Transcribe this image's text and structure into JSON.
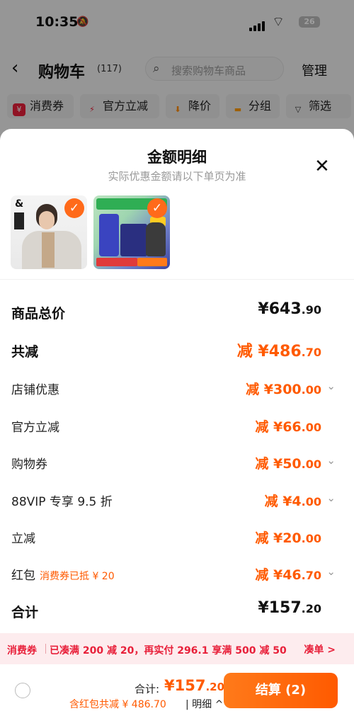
{
  "status": {
    "time": "10:35",
    "battery": "26"
  },
  "header": {
    "title": "购物车",
    "count": "(117)",
    "search_placeholder": "搜索购物车商品",
    "manage": "管理"
  },
  "filters": [
    {
      "label": "消费券",
      "icon": "ticket-icon",
      "icon_glyph": "¥",
      "icon_color": "#e8203a"
    },
    {
      "label": "官方立减",
      "icon": "lightning-icon",
      "icon_glyph": "⚡",
      "icon_color": "#e8203a"
    },
    {
      "label": "降价",
      "icon": "down-arrow-icon",
      "icon_glyph": "⬇",
      "icon_color": "#ff8a00"
    },
    {
      "label": "分组",
      "icon": "folder-icon",
      "icon_glyph": "▬",
      "icon_color": "#ff9a00"
    },
    {
      "label": "筛选",
      "icon": "filter-icon",
      "icon_glyph": "▽",
      "icon_color": "#333333"
    }
  ],
  "sheet": {
    "title": "金额明细",
    "subtitle": "实际优惠金额请以下单页为准",
    "rows": [
      {
        "label": "商品总价",
        "amount_int": "¥643",
        "amount_dec": ".90",
        "note": ""
      },
      {
        "label": "共减",
        "amount_int": "减 ¥486",
        "amount_dec": ".70",
        "note": ""
      },
      {
        "label": "店铺优惠",
        "amount_int": "减 ¥300",
        "amount_dec": ".00",
        "note": ""
      },
      {
        "label": "官方立减",
        "amount_int": "减 ¥66",
        "amount_dec": ".00",
        "note": ""
      },
      {
        "label": "购物券",
        "amount_int": "减 ¥50",
        "amount_dec": ".00",
        "note": ""
      },
      {
        "label": "88VIP 专享 9.5 折",
        "amount_int": "减 ¥4",
        "amount_dec": ".00",
        "note": ""
      },
      {
        "label": "立减",
        "amount_int": "减 ¥20",
        "amount_dec": ".00",
        "note": ""
      },
      {
        "label": "红包",
        "amount_int": "减 ¥46",
        "amount_dec": ".70",
        "note": "消费券已抵 ¥ 20"
      },
      {
        "label": "合计",
        "amount_int": "¥157",
        "amount_dec": ".20",
        "note": ""
      }
    ]
  },
  "promo": {
    "tag": "消费券",
    "text": "已凑满 200 减 20，再实付 296.1 享满 500 减 50",
    "link": "凑单 >"
  },
  "footer": {
    "total_label": "合计:",
    "total_int": "¥157",
    "total_dec": ".20",
    "savings": "含红包共减 ¥ 486.70",
    "detail": "| 明细 ^",
    "checkout": "结算 (2)"
  },
  "colors": {
    "accent": "#ff5a00",
    "promo_red": "#e8203a"
  }
}
